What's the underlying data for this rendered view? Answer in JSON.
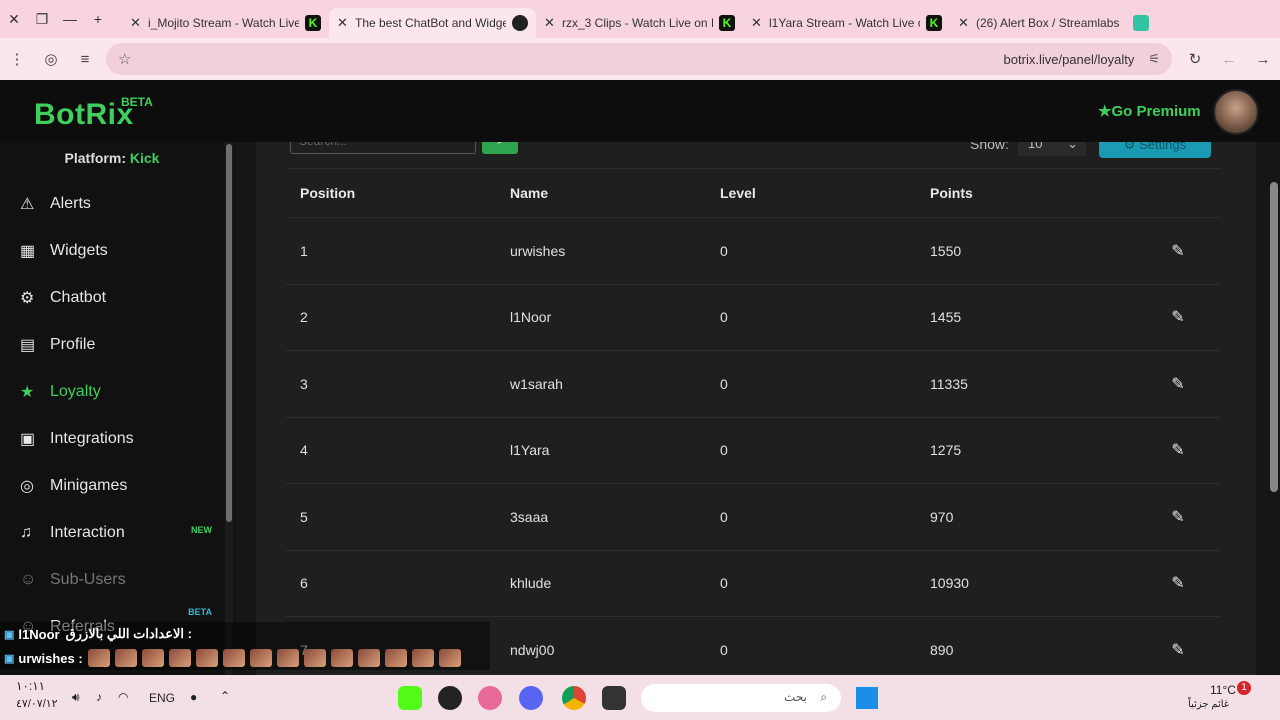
{
  "browser": {
    "tabs": [
      {
        "title": "i_Mojito Stream - Watch Live",
        "favicon": "kick",
        "active": false
      },
      {
        "title": "The best ChatBot and Widge",
        "favicon": "botrix",
        "active": true
      },
      {
        "title": "rzx_3 Clips - Watch Live on K",
        "favicon": "kick",
        "active": false
      },
      {
        "title": "l1Yara Stream - Watch Live o",
        "favicon": "kick",
        "active": false
      },
      {
        "title": "(26) Alert Box / Streamlabs",
        "favicon": "streamlabs",
        "active": false
      }
    ],
    "url": "botrix.live/panel/loyalty"
  },
  "app": {
    "logo": "BotRix",
    "logo_badge": "BETA",
    "premium_label": "★Go Premium",
    "platform_label": "Platform:",
    "platform_value": "Kick"
  },
  "sidebar": {
    "items": [
      {
        "label": "Alerts",
        "icon": "warning-icon",
        "glyph": "⚠"
      },
      {
        "label": "Widgets",
        "icon": "grid-icon",
        "glyph": "▦"
      },
      {
        "label": "Chatbot",
        "icon": "robot-icon",
        "glyph": "⚙"
      },
      {
        "label": "Profile",
        "icon": "id-card-icon",
        "glyph": "▤"
      },
      {
        "label": "Loyalty",
        "icon": "trophy-icon",
        "glyph": "★",
        "active": true
      },
      {
        "label": "Integrations",
        "icon": "plugin-icon",
        "glyph": "▣"
      },
      {
        "label": "Minigames",
        "icon": "gamepad-icon",
        "glyph": "◎"
      },
      {
        "label": "Interaction",
        "icon": "music-icon",
        "glyph": "♫",
        "badge": "NEW"
      },
      {
        "label": "Sub-Users",
        "icon": "users-icon",
        "glyph": "☺",
        "dim": true
      },
      {
        "label": "Referrals",
        "icon": "referral-icon",
        "glyph": "☺",
        "badge": "BETA"
      }
    ]
  },
  "toolbar": {
    "search_placeholder": "Search...",
    "show_label": "Show:",
    "show_value": "10",
    "settings_label": "⚙ Settings"
  },
  "table": {
    "headers": [
      "Position",
      "Name",
      "Level",
      "Points"
    ],
    "rows": [
      {
        "position": "1",
        "name": "urwishes",
        "level": "0",
        "points": "1550"
      },
      {
        "position": "2",
        "name": "l1Noor",
        "level": "0",
        "points": "1455"
      },
      {
        "position": "3",
        "name": "w1sarah",
        "level": "0",
        "points": "11335"
      },
      {
        "position": "4",
        "name": "l1Yara",
        "level": "0",
        "points": "1275"
      },
      {
        "position": "5",
        "name": "3saaa",
        "level": "0",
        "points": "970"
      },
      {
        "position": "6",
        "name": "khlude",
        "level": "0",
        "points": "10930"
      },
      {
        "position": "7",
        "name": "ndwj00",
        "level": "0",
        "points": "890"
      }
    ]
  },
  "chat_overlay": [
    {
      "user": "l1Noor",
      "message": "الاعدادات اللي بالازرق :"
    },
    {
      "user": "urwishes :",
      "message": ""
    }
  ],
  "taskbar": {
    "time": "١٠:١١",
    "date": "٤٧/٠٧/١٢",
    "lang": "ENG",
    "search_placeholder": "بحث",
    "weather_temp": "11°C",
    "weather_text": "غائم جزئياً"
  }
}
